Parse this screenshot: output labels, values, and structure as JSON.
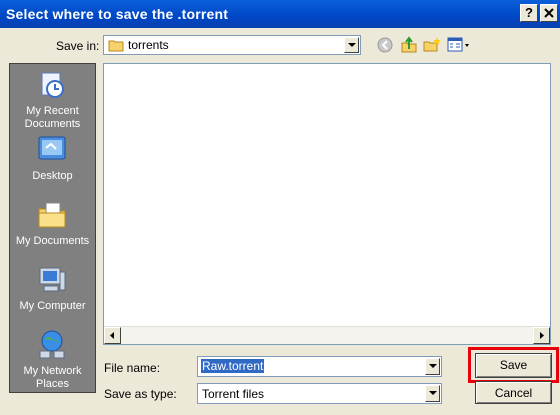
{
  "window": {
    "title": "Select where to save the .torrent",
    "help_btn": "?",
    "close_btn": "X"
  },
  "toolbar": {
    "save_in_label": "Save in:",
    "save_in_value": "torrents",
    "icons": [
      "back-icon",
      "up-folder-icon",
      "new-folder-icon",
      "views-menu-icon"
    ]
  },
  "places": [
    {
      "label": "My Recent Documents",
      "icon": "recent-documents-icon"
    },
    {
      "label": "Desktop",
      "icon": "desktop-icon"
    },
    {
      "label": "My Documents",
      "icon": "my-documents-icon"
    },
    {
      "label": "My Computer",
      "icon": "my-computer-icon"
    },
    {
      "label": "My Network Places",
      "icon": "network-places-icon"
    }
  ],
  "form": {
    "filename_label": "File name:",
    "filename_value": "Raw.torrent",
    "savetype_label": "Save as type:",
    "savetype_value": "Torrent files"
  },
  "buttons": {
    "save": "Save",
    "cancel": "Cancel"
  },
  "colors": {
    "titlebar": "#0047c6",
    "highlight": "#e8000b",
    "places_bg": "#808080",
    "face": "#ece9d8"
  }
}
